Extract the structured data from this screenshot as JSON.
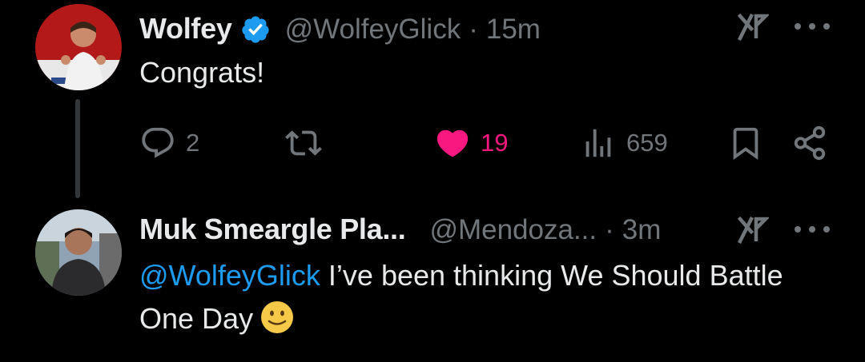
{
  "tweets": [
    {
      "name": "Wolfey",
      "handle": "@WolfeyGlick",
      "separator": "·",
      "time": "15m",
      "text": "Congrats!",
      "verified": true,
      "actions": {
        "replies": "2",
        "retweets": "",
        "likes": "19",
        "views": "659"
      }
    },
    {
      "name": "Muk Smeargle Pla...",
      "handle": "@Mendoza...",
      "separator": "·",
      "time": "3m",
      "mention": "@WolfeyGlick",
      "text": " I’ve been thinking We Should Battle One Day",
      "emoji": "slightly-smiling-face"
    }
  ],
  "icons": {
    "verified": "verified-badge-icon",
    "grok": "grok-icon",
    "more": "more-icon",
    "reply": "reply-icon",
    "retweet": "retweet-icon",
    "like": "heart-icon",
    "views": "views-icon",
    "bookmark": "bookmark-icon",
    "share": "share-icon"
  },
  "colors": {
    "background": "#000000",
    "text": "#e7e9ea",
    "muted": "#71767b",
    "accent": "#1d9bf0",
    "like": "#f91880",
    "thread_line": "#333639"
  }
}
